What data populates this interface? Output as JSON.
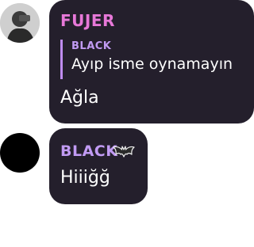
{
  "messages": [
    {
      "sender": "FUJER",
      "sender_color": "#e778d8",
      "reply": {
        "sender": "BLACK",
        "text": "Ayıp isme oynamayın"
      },
      "text": "Ağla"
    },
    {
      "sender": "BLACK",
      "sender_color": "#c19bf3",
      "badge_icon": "bat-icon",
      "text": "Hiiiğğ"
    }
  ],
  "colors": {
    "bubble": "#241f2c",
    "quote_bar": "#bf8cf0"
  }
}
